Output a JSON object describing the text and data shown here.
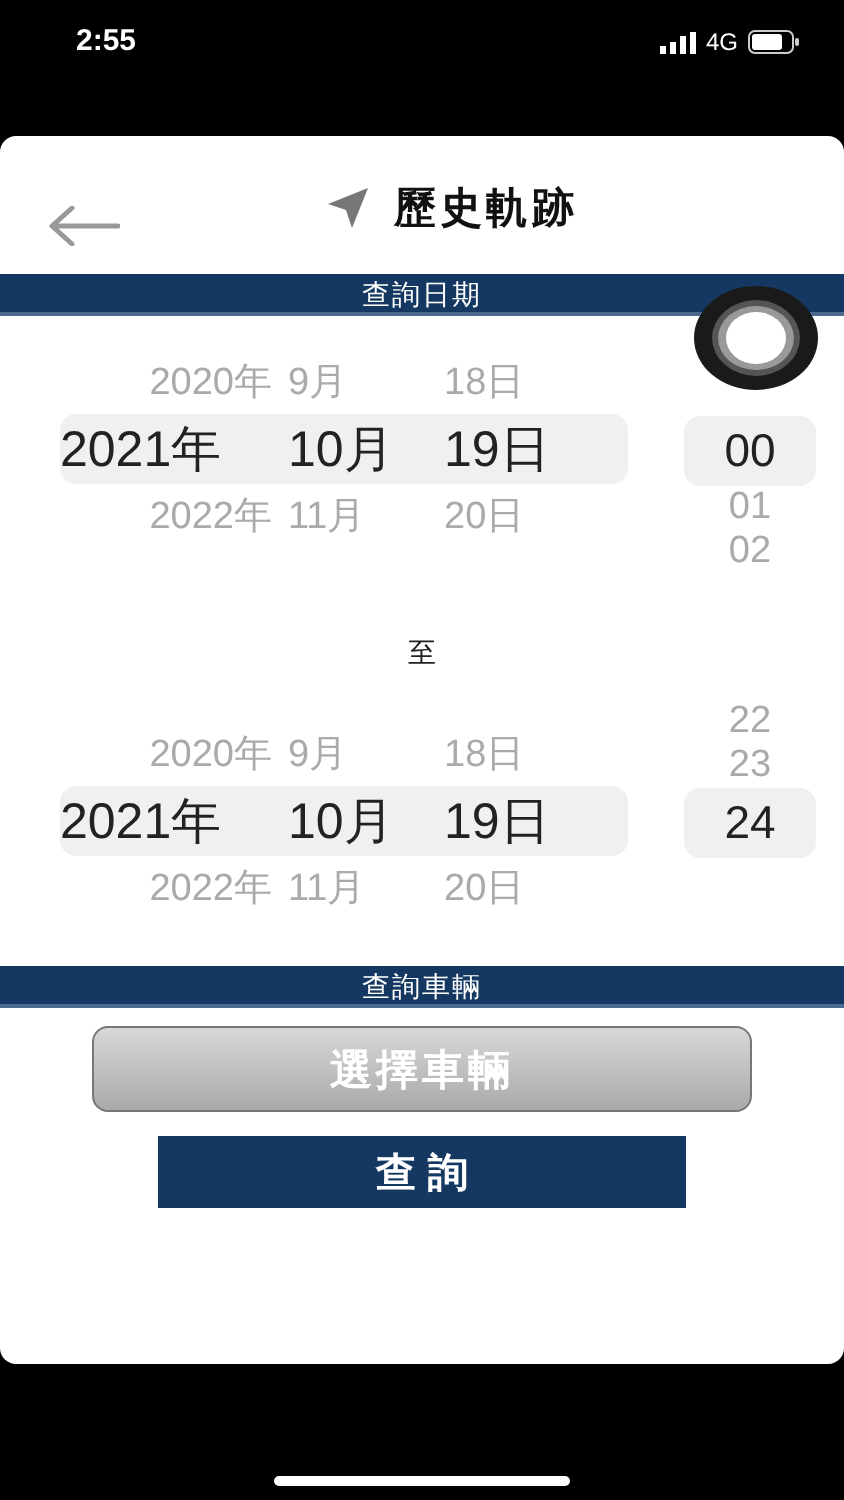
{
  "status_bar": {
    "time": "2:55",
    "network": "4G"
  },
  "header": {
    "title": "歷史軌跡"
  },
  "date_section": {
    "label": "查詢日期"
  },
  "start_picker": {
    "dates": [
      {
        "year": "2020年",
        "month": "9月",
        "day": "18日",
        "selected": false
      },
      {
        "year": "2021年",
        "month": "10月",
        "day": "19日",
        "selected": true
      },
      {
        "year": "2022年",
        "month": "11月",
        "day": "20日",
        "selected": false
      }
    ],
    "hours": [
      {
        "label": "00",
        "selected": true
      },
      {
        "label": "01",
        "selected": false
      },
      {
        "label": "02",
        "selected": false
      }
    ]
  },
  "separator": "至",
  "end_picker": {
    "dates": [
      {
        "year": "2020年",
        "month": "9月",
        "day": "18日",
        "selected": false
      },
      {
        "year": "2021年",
        "month": "10月",
        "day": "19日",
        "selected": true
      },
      {
        "year": "2022年",
        "month": "11月",
        "day": "20日",
        "selected": false
      }
    ],
    "hours": [
      {
        "label": "22",
        "selected": false
      },
      {
        "label": "23",
        "selected": false
      },
      {
        "label": "24",
        "selected": true
      }
    ]
  },
  "vehicle_section": {
    "label": "查詢車輛"
  },
  "select_vehicle_button": "選擇車輛",
  "query_button": "查 詢"
}
